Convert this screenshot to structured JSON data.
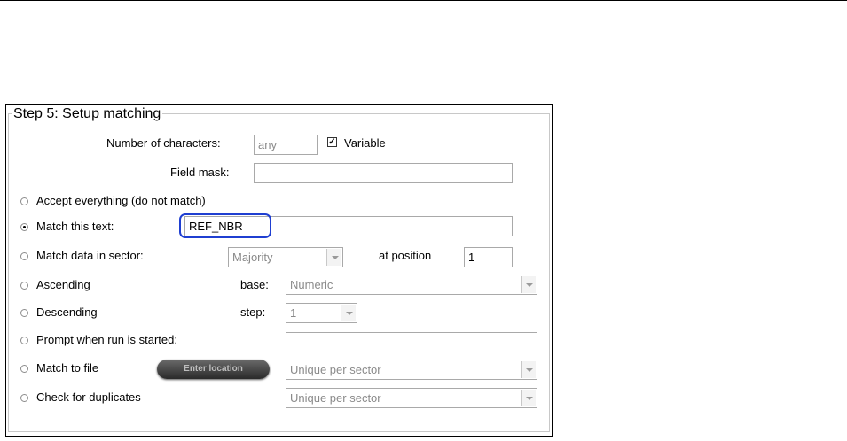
{
  "panel": {
    "title": "Step 5: Setup matching"
  },
  "num_chars": {
    "label": "Number of characters:",
    "value": "any",
    "variable_label": "Variable",
    "variable_checked": true
  },
  "field_mask": {
    "label": "Field mask:",
    "value": ""
  },
  "options": {
    "accept_everything": "Accept everything (do not match)",
    "match_text": "Match this text:",
    "match_sector": "Match data in sector:",
    "ascending": "Ascending",
    "descending": "Descending",
    "prompt": "Prompt when run is started:",
    "match_file": "Match to file",
    "check_duplicates": "Check for duplicates"
  },
  "match_text_value": "REF_NBR",
  "sector": {
    "select_value": "Majority",
    "position_label": "at position",
    "position_value": "1"
  },
  "base": {
    "label": "base:",
    "value": "Numeric"
  },
  "step": {
    "label": "step:",
    "value": "1"
  },
  "prompt_value": "",
  "enter_location_label": "Enter location",
  "match_file_select": "Unique per sector",
  "duplicates_select": "Unique per sector"
}
